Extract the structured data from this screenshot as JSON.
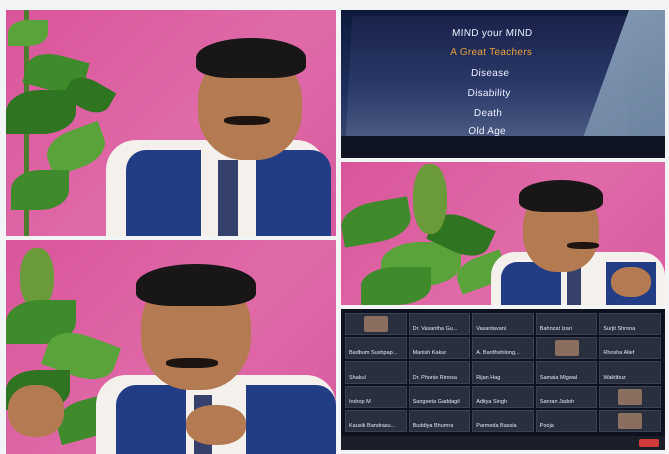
{
  "slide": {
    "lines": [
      "MIND your MIND",
      "A Great Teachers",
      "Disease",
      "Disability",
      "Death",
      "Old Age"
    ]
  },
  "meeting": {
    "tiles": [
      {
        "name": ""
      },
      {
        "name": "Dr. Vasantha Gu..."
      },
      {
        "name": "Vasantavani"
      },
      {
        "name": "Bahnzat Izari"
      },
      {
        "name": "Surjit Shrona"
      },
      {
        "name": "Badbum Sushpap..."
      },
      {
        "name": "Manish Kakur"
      },
      {
        "name": "A. Bardhshilong..."
      },
      {
        "name": ""
      },
      {
        "name": "Rhosha Alief"
      },
      {
        "name": "Shakul"
      },
      {
        "name": "Dr. Phonie Rinosa"
      },
      {
        "name": "Rijan Hag"
      },
      {
        "name": "Samaia Migwal"
      },
      {
        "name": "Waktibuz"
      },
      {
        "name": "Indrop M"
      },
      {
        "name": "Sangeeta Gaddagil"
      },
      {
        "name": "Aditya Singh"
      },
      {
        "name": "Sanran Jadoh"
      },
      {
        "name": ""
      },
      {
        "name": "Kausik Bandrasu..."
      },
      {
        "name": "Buddiya Bhumra"
      },
      {
        "name": "Parmeda Bassia"
      },
      {
        "name": "Pooja"
      },
      {
        "name": ""
      }
    ]
  }
}
